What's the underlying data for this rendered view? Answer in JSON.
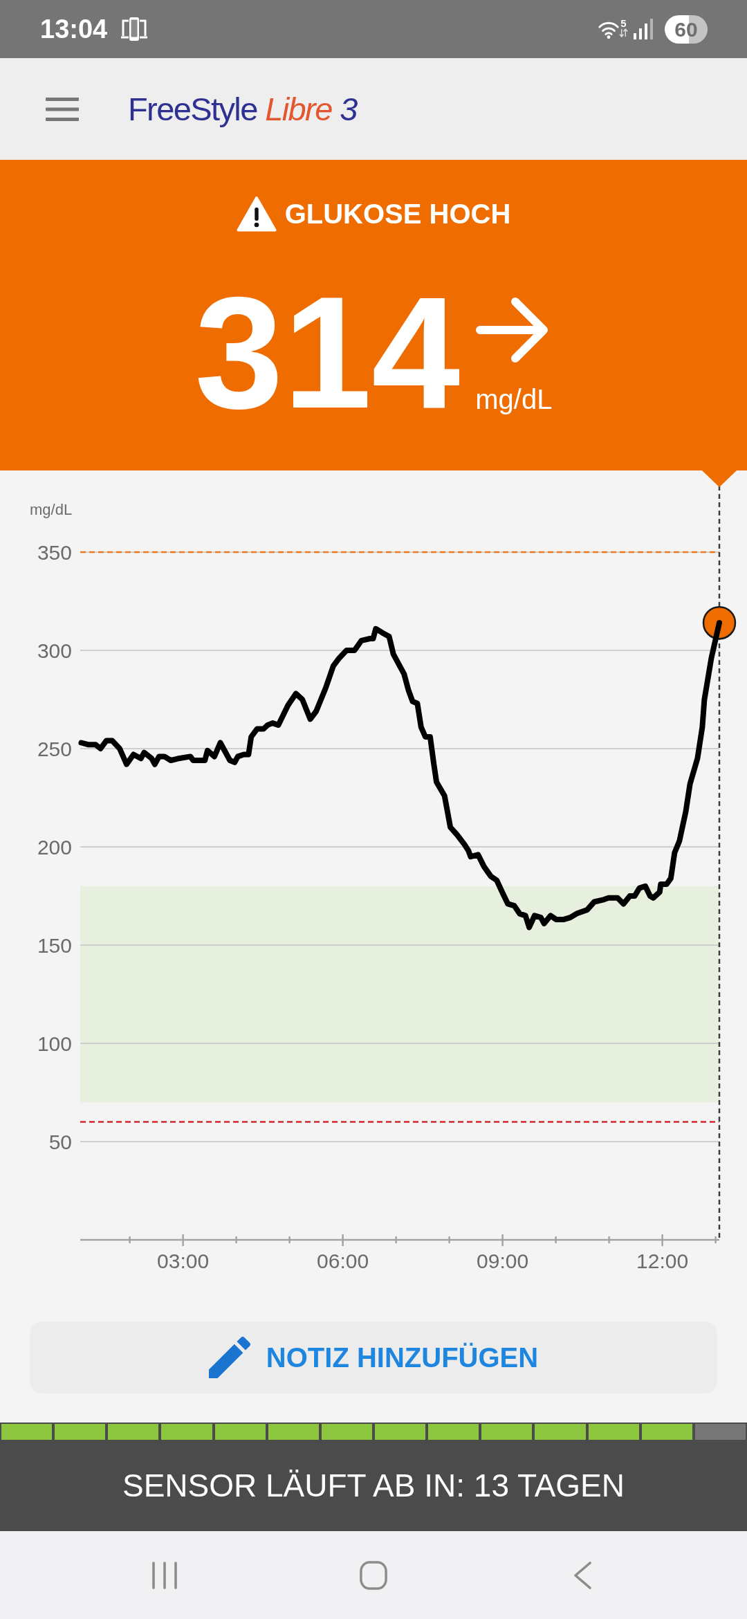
{
  "status_bar": {
    "time": "13:04",
    "wifi_badge": "5",
    "battery": "60"
  },
  "app_bar": {
    "logo": [
      {
        "kind": "brand",
        "text": "FreeStyle"
      },
      {
        "kind": "product",
        "text": "Libre"
      },
      {
        "kind": "version",
        "text": "3"
      }
    ]
  },
  "alert": {
    "high": true,
    "title": "GLUKOSE HOCH",
    "value": "314",
    "unit": "mg/dL",
    "rising": false,
    "falling": false
  },
  "chart": {
    "chart_data": {
      "type": "line",
      "ylabel": "mg/dL",
      "x": [
        1.09,
        1.23,
        1.36,
        1.45,
        1.56,
        1.67,
        1.81,
        1.94,
        2.07,
        2.21,
        2.27,
        2.41,
        2.47,
        2.55,
        2.65,
        2.77,
        2.92,
        3.14,
        3.19,
        3.41,
        3.46,
        3.59,
        3.7,
        3.88,
        3.97,
        4.03,
        4.14,
        4.23,
        4.28,
        4.39,
        4.51,
        4.59,
        4.68,
        4.79,
        4.97,
        5.12,
        5.24,
        5.39,
        5.5,
        5.68,
        5.82,
        5.93,
        6.07,
        6.22,
        6.35,
        6.51,
        6.57,
        6.62,
        6.74,
        6.87,
        6.95,
        7.05,
        7.15,
        7.23,
        7.31,
        7.4,
        7.47,
        7.55,
        7.64,
        7.71,
        7.76,
        7.91,
        8.02,
        8.15,
        8.29,
        8.36,
        8.4,
        8.54,
        8.65,
        8.78,
        8.89,
        9.01,
        9.1,
        9.22,
        9.32,
        9.43,
        9.5,
        9.6,
        9.72,
        9.78,
        9.9,
        10.01,
        10.14,
        10.27,
        10.39,
        10.59,
        10.72,
        10.88,
        10.99,
        11.16,
        11.27,
        11.39,
        11.48,
        11.57,
        11.68,
        11.77,
        11.83,
        11.95,
        11.97,
        12.08,
        12.16,
        12.23,
        12.32,
        12.44,
        12.52,
        12.66,
        12.75,
        12.79,
        12.92,
        13.07
      ],
      "series": [
        {
          "color": "#000000",
          "values": [
            253,
            252,
            252,
            250,
            254,
            254,
            250,
            242,
            247,
            245,
            248,
            245,
            242,
            246,
            246,
            244,
            245,
            246,
            244,
            244,
            249,
            246,
            253,
            244,
            243,
            246,
            247,
            247,
            256,
            260,
            260,
            262,
            263,
            262,
            272,
            278,
            275,
            265,
            269,
            281,
            292,
            296,
            300,
            300,
            305,
            306,
            306,
            311,
            309,
            307,
            298,
            293,
            288,
            280,
            274,
            273,
            261,
            256,
            256,
            242,
            233,
            226,
            210,
            206,
            201,
            198,
            195,
            196,
            190,
            185,
            183,
            176,
            171,
            170,
            166,
            165,
            159,
            165,
            164,
            161,
            165,
            163,
            163,
            164,
            166,
            168,
            172,
            173,
            174,
            174,
            171,
            175,
            175,
            179,
            180,
            175,
            174,
            177,
            181,
            181,
            184,
            197,
            203,
            218,
            232,
            245,
            261,
            275,
            296,
            314
          ]
        }
      ],
      "xlim": [
        1.07,
        13.07
      ],
      "ylim": [
        0,
        350
      ],
      "xticks": [
        {
          "value": 3,
          "label": "03:00"
        },
        {
          "value": 6,
          "label": "06:00"
        },
        {
          "value": 9,
          "label": "09:00"
        },
        {
          "value": 12,
          "label": "12:00"
        }
      ],
      "yticks": [
        50,
        100,
        150,
        200,
        250,
        300,
        350
      ],
      "grid": true,
      "bands": [
        {
          "axis": "y",
          "from": 70,
          "to": 180,
          "color": "#e7f0df"
        }
      ],
      "ref_lines": [
        {
          "axis": "y",
          "value": 350,
          "color": "#ec7a22"
        },
        {
          "axis": "y",
          "value": 60,
          "color": "#d22630"
        },
        {
          "axis": "x",
          "value": 13.07,
          "color": "#3c3c3c"
        }
      ]
    }
  },
  "note_button": {
    "label": "NOTIZ HINZUFÜGEN"
  },
  "sensor": {
    "segments": [
      {
        "filled": true
      },
      {
        "filled": true
      },
      {
        "filled": true
      },
      {
        "filled": true
      },
      {
        "filled": true
      },
      {
        "filled": true
      },
      {
        "filled": true
      },
      {
        "filled": true
      },
      {
        "filled": true
      },
      {
        "filled": true
      },
      {
        "filled": true
      },
      {
        "filled": true
      },
      {
        "filled": true
      },
      {
        "filled": false
      }
    ],
    "text": "SENSOR LÄUFT AB IN: 13 TAGEN"
  }
}
